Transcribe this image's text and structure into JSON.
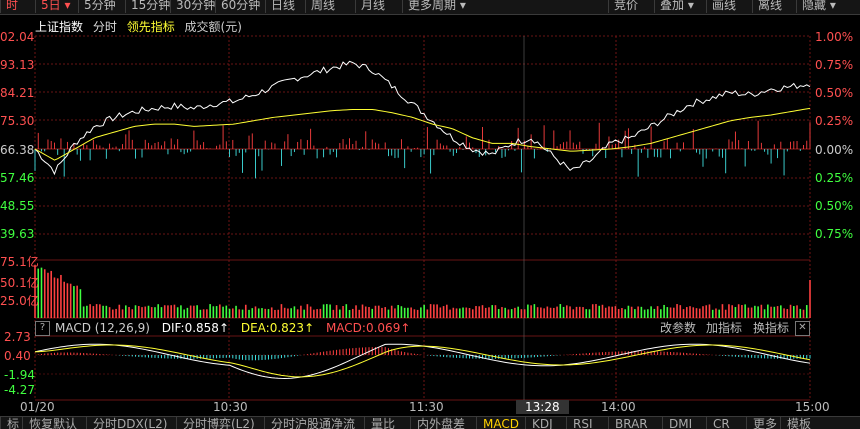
{
  "toolbar": {
    "items": [
      "时",
      "5日",
      "5分钟",
      "15分钟",
      "30分钟",
      "60分钟",
      "日线",
      "周线",
      "月线",
      "更多周期"
    ],
    "active_index": 1,
    "right_items": [
      "竞价",
      "叠加",
      "画线",
      "离线",
      "隐藏"
    ]
  },
  "legend": {
    "index_name": "上证指数",
    "mode": "分时",
    "leading": "领先指标",
    "volume": "成交额(元)"
  },
  "main_axis": {
    "left_labels": [
      "02.04",
      "93.13",
      "84.21",
      "75.30",
      "66.38",
      "57.46",
      "48.55",
      "39.63"
    ],
    "right_labels": [
      "1.00%",
      "0.75%",
      "0.50%",
      "0.25%",
      "0.00%",
      "0.25%",
      "0.50%",
      "0.75%"
    ]
  },
  "volume_axis": {
    "labels": [
      "75.1亿",
      "50.1亿",
      "25.0亿"
    ]
  },
  "macd": {
    "title": "MACD (12,26,9)",
    "dif_label": "DIF:",
    "dif_value": "0.858",
    "dea_label": "DEA:",
    "dea_value": "0.823",
    "macd_label": "MACD:",
    "macd_value": "0.069",
    "axis_labels": [
      "2.73",
      "0.40",
      "-1.94",
      "-4.27"
    ],
    "buttons": [
      "改参数",
      "加指标",
      "换指标"
    ]
  },
  "time_axis": {
    "labels": [
      "01/20",
      "10:30",
      "11:30",
      "14:00",
      "15:00"
    ],
    "cursor_time": "13:28"
  },
  "bottom_tabs": {
    "items": [
      "标",
      "恢复默认",
      "分时DDX(L2)",
      "分时博弈(L2)",
      "分时沪股通净流",
      "量比",
      "内外盘差",
      "MACD",
      "KDJ",
      "RSI",
      "BRAR",
      "DMI",
      "CR",
      "更多",
      "模板"
    ],
    "active_index": 7
  },
  "colors": {
    "up": "#ff4040",
    "down": "#40e0e0",
    "price_line": "#ffffff",
    "avg_line": "#ffff33",
    "grid": "#8b1a1a",
    "volume_up": "#ff4040",
    "volume_down": "#40ff40"
  },
  "chart_data": {
    "type": "line",
    "title": "",
    "x_labels": [
      "01/20",
      "10:30",
      "11:30",
      "14:00",
      "15:00"
    ],
    "price_pct": [
      0.0,
      -0.2,
      0.05,
      0.2,
      0.28,
      0.33,
      0.36,
      0.38,
      0.36,
      0.4,
      0.42,
      0.48,
      0.55,
      0.62,
      0.67,
      0.72,
      0.76,
      0.7,
      0.55,
      0.4,
      0.25,
      0.1,
      0.0,
      -0.05,
      0.05,
      0.1,
      -0.05,
      -0.2,
      -0.1,
      0.05,
      0.1,
      0.2,
      0.3,
      0.4,
      0.45,
      0.5,
      0.48,
      0.53,
      0.55,
      0.58
    ],
    "avg_pct": [
      0.0,
      -0.1,
      0.0,
      0.1,
      0.15,
      0.2,
      0.22,
      0.22,
      0.2,
      0.21,
      0.22,
      0.25,
      0.28,
      0.3,
      0.32,
      0.34,
      0.35,
      0.35,
      0.32,
      0.28,
      0.22,
      0.18,
      0.1,
      0.05,
      0.05,
      0.02,
      0.0,
      -0.02,
      -0.01,
      0.0,
      0.02,
      0.05,
      0.1,
      0.15,
      0.2,
      0.25,
      0.28,
      0.3,
      0.33,
      0.36
    ]
  }
}
